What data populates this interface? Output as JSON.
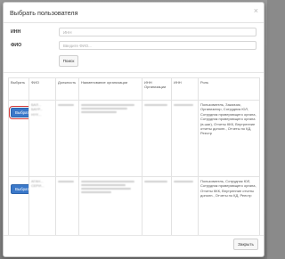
{
  "dialog": {
    "title": "Выбрать пользователя",
    "close_symbol": "×"
  },
  "form": {
    "inn_label": "ИНН",
    "inn_placeholder": "ИНН",
    "fio_label": "ФИО",
    "fio_placeholder": "Введите ФИО...",
    "search_button": "Поиск"
  },
  "table": {
    "headers": [
      "Выбрать",
      "ФИО",
      "Должность",
      "Наименование организации",
      "ИНН Организации",
      "ИНН",
      "Роль"
    ],
    "rows": [
      {
        "select_label": "Выбрать",
        "fio_lines": [
          "БАЛ...",
          "БАУР...",
          "НУХ..."
        ],
        "role": "Пользователь, Заказчик, Организатор, Сотрудник ЮЛ, Сотрудник проверяющего органа, Сотрудник проверяющего органа (в.шаг), Отчеты ККК, Внутренние отчеты дополн., Отчеты по КД, Реестр"
      },
      {
        "select_label": "Выбрать",
        "fio_lines": [
          "АГАН...",
          "СЕРИ..."
        ],
        "role": "Пользователь, Сотрудник ЮЛ, Сотрудник проверяющего органа, Отчеты ККК, Внутренние отчеты дополн., Отчеты по КД, Реестр"
      }
    ]
  },
  "footer": {
    "close_button": "Закрыть"
  }
}
